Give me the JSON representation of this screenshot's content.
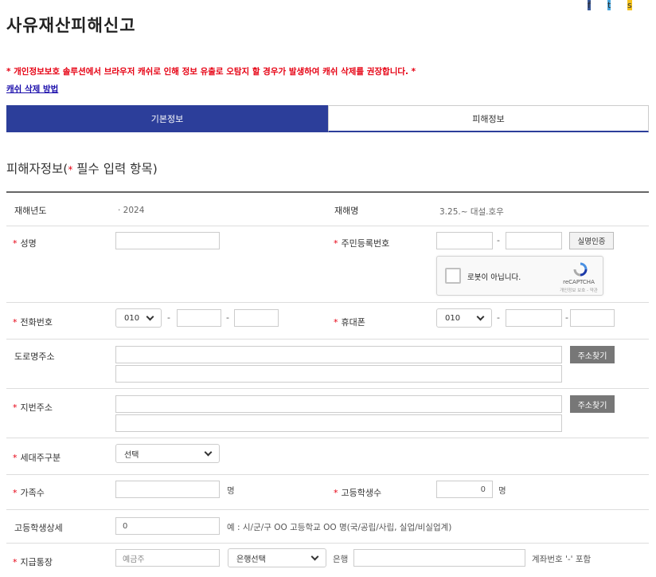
{
  "header": {
    "title": "사유재산피해신고",
    "share": [
      {
        "icon": "facebook-icon",
        "glyph": "f",
        "color": "#3b5998"
      },
      {
        "icon": "twitter-icon",
        "glyph": "t",
        "color": "#4aa8e0"
      },
      {
        "icon": "kakaostory-icon",
        "glyph": "s",
        "color": "#f6c31c"
      }
    ]
  },
  "notice": {
    "warning": "* 개인정보보호 솔루션에서 브라우저 캐쉬로 인해 정보 유출로 오탐지 할 경우가 발생하여 캐쉬 삭제를 권장합니다. *",
    "cache_link": "캐쉬 삭제 방법"
  },
  "tabs": [
    {
      "label": "기본정보",
      "active": true
    },
    {
      "label": "피해정보",
      "active": false
    }
  ],
  "section": {
    "title_prefix": "피해자정보(",
    "star": "*",
    "title_suffix": " 필수 입력 항목)"
  },
  "form": {
    "required_mark": "*",
    "disaster_year": {
      "label": "재해년도",
      "value": "· 2024"
    },
    "disaster_name": {
      "label": "재해명",
      "value": "3.25.~ 대설.호우"
    },
    "name": {
      "label": "성명",
      "value": ""
    },
    "rrn": {
      "label": "주민등록번호",
      "dash": "-",
      "verify_button": "실명인증"
    },
    "recaptcha": {
      "text": "로봇이 아닙니다.",
      "brand": "reCAPTCHA",
      "terms": "개인정보 보호 - 약관"
    },
    "phone": {
      "label": "전화번호",
      "prefix": "010",
      "dash": "-"
    },
    "mobile": {
      "label": "휴대폰",
      "prefix": "010",
      "dash": "-"
    },
    "road_address": {
      "label": "도로명주소",
      "search_button": "주소찾기"
    },
    "lot_address": {
      "label": "지번주소",
      "search_button": "주소찾기"
    },
    "household": {
      "label": "세대주구분",
      "selected": "선택"
    },
    "family_count": {
      "label": "가족수",
      "unit": "명",
      "value": ""
    },
    "hs_students": {
      "label": "고등학생수",
      "value": "0",
      "unit": "명"
    },
    "hs_detail": {
      "label": "고등학생상세",
      "value": "0",
      "hint": "예 : 시/군/구 OO 고등학교 OO 명(국/공립/사립, 실업/비실업계)"
    },
    "bank_account": {
      "label": "지급통장",
      "holder_placeholder": "예금주",
      "bank_selected": "은행선택",
      "bank_suffix": "은행",
      "account_hint": "계좌번호 '-' 포함"
    }
  }
}
